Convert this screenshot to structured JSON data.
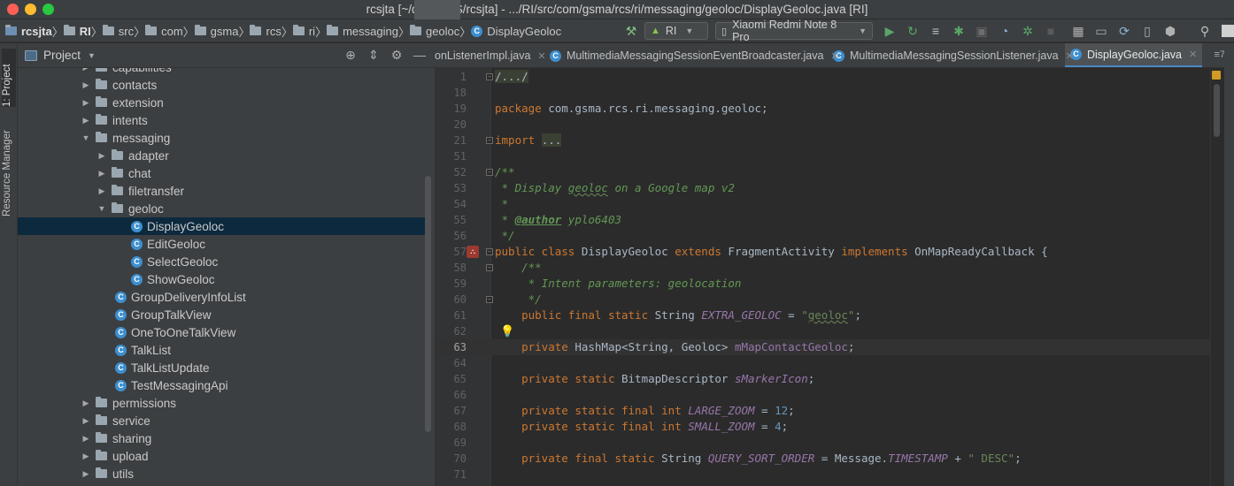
{
  "window": {
    "title": "rcsjta [~/dev/       RCS/rcsjta] - .../RI/src/com/gsma/rcs/ri/messaging/geoloc/DisplayGeoloc.java [RI]"
  },
  "breadcrumbs": [
    "rcsjta",
    "RI",
    "src",
    "com",
    "gsma",
    "rcs",
    "ri",
    "messaging",
    "geoloc",
    "DisplayGeoloc"
  ],
  "toolbar": {
    "module": "RI",
    "device": "Xiaomi Redmi Note 8 Pro"
  },
  "left_stripe": {
    "project_tab": "1: Project",
    "resource_tab": "Resource Manager"
  },
  "project_panel": {
    "title": "Project",
    "tree": [
      {
        "label": "capabilities",
        "type": "folder",
        "depth": 0,
        "state": "collapsed"
      },
      {
        "label": "contacts",
        "type": "folder",
        "depth": 0,
        "state": "collapsed"
      },
      {
        "label": "extension",
        "type": "folder",
        "depth": 0,
        "state": "collapsed"
      },
      {
        "label": "intents",
        "type": "folder",
        "depth": 0,
        "state": "collapsed"
      },
      {
        "label": "messaging",
        "type": "folder",
        "depth": 0,
        "state": "expanded"
      },
      {
        "label": "adapter",
        "type": "folder",
        "depth": 1,
        "state": "collapsed"
      },
      {
        "label": "chat",
        "type": "folder",
        "depth": 1,
        "state": "collapsed"
      },
      {
        "label": "filetransfer",
        "type": "folder",
        "depth": 1,
        "state": "collapsed"
      },
      {
        "label": "geoloc",
        "type": "folder",
        "depth": 1,
        "state": "expanded"
      },
      {
        "label": "DisplayGeoloc",
        "type": "class",
        "depth": 2,
        "state": "selected"
      },
      {
        "label": "EditGeoloc",
        "type": "class",
        "depth": 2,
        "state": ""
      },
      {
        "label": "SelectGeoloc",
        "type": "class",
        "depth": 2,
        "state": ""
      },
      {
        "label": "ShowGeoloc",
        "type": "class",
        "depth": 2,
        "state": ""
      },
      {
        "label": "GroupDeliveryInfoList",
        "type": "class",
        "depth": 1,
        "state": ""
      },
      {
        "label": "GroupTalkView",
        "type": "class",
        "depth": 1,
        "state": ""
      },
      {
        "label": "OneToOneTalkView",
        "type": "class",
        "depth": 1,
        "state": ""
      },
      {
        "label": "TalkList",
        "type": "class",
        "depth": 1,
        "state": ""
      },
      {
        "label": "TalkListUpdate",
        "type": "class",
        "depth": 1,
        "state": ""
      },
      {
        "label": "TestMessagingApi",
        "type": "class",
        "depth": 1,
        "state": ""
      },
      {
        "label": "permissions",
        "type": "folder",
        "depth": 0,
        "state": "collapsed"
      },
      {
        "label": "service",
        "type": "folder",
        "depth": 0,
        "state": "collapsed"
      },
      {
        "label": "sharing",
        "type": "folder",
        "depth": 0,
        "state": "collapsed"
      },
      {
        "label": "upload",
        "type": "folder",
        "depth": 0,
        "state": "collapsed"
      },
      {
        "label": "utils",
        "type": "folder",
        "depth": 0,
        "state": "collapsed"
      }
    ]
  },
  "editor_tabs": [
    {
      "label": "onListenerImpl.java",
      "active": false,
      "icon": false
    },
    {
      "label": "MultimediaMessagingSessionEventBroadcaster.java",
      "active": false,
      "icon": true
    },
    {
      "label": "MultimediaMessagingSessionListener.java",
      "active": false,
      "icon": true
    },
    {
      "label": "DisplayGeoloc.java",
      "active": true,
      "icon": true
    }
  ],
  "editor_tabs_more": "7",
  "current_line": 63,
  "code_lines": [
    {
      "n": "1",
      "html": "<span class=\"fold-box\">/.../</span>"
    },
    {
      "n": "18",
      "html": ""
    },
    {
      "n": "19",
      "html": "<span class=\"kw\">package</span> com.gsma.rcs.ri.messaging.geoloc;"
    },
    {
      "n": "20",
      "html": ""
    },
    {
      "n": "21",
      "html": "<span class=\"kw\">import</span> <span class=\"fold-box\">...</span>"
    },
    {
      "n": "51",
      "html": ""
    },
    {
      "n": "52",
      "html": "<span class=\"cm\">/**</span>"
    },
    {
      "n": "53",
      "html": "<span class=\"cm\"> * Display <span class=\"wavy\">geoloc</span> on a Google map v2</span>"
    },
    {
      "n": "54",
      "html": "<span class=\"cm\"> *</span>"
    },
    {
      "n": "55",
      "html": "<span class=\"cm\"> * </span><span class=\"tag\">@author</span><span class=\"cm\"> yplo6403</span>"
    },
    {
      "n": "56",
      "html": "<span class=\"cm\"> */</span>"
    },
    {
      "n": "57",
      "html": "<span class=\"kw\">public class</span> DisplayGeoloc <span class=\"kw\">extends</span> FragmentActivity <span class=\"kw\">implements</span> OnMapReadyCallback {"
    },
    {
      "n": "58",
      "html": "    <span class=\"cm\">/**</span>"
    },
    {
      "n": "59",
      "html": "<span class=\"cm\">     * Intent parameters: geolocation</span>"
    },
    {
      "n": "60",
      "html": "<span class=\"cm\">     */</span>"
    },
    {
      "n": "61",
      "html": "    <span class=\"kw\">public final static</span> String <span class=\"cn\">EXTRA_GEOLOC</span> = <span class=\"st\">\"<span class=\"wavy\">geoloc</span>\"</span>;"
    },
    {
      "n": "62",
      "html": ""
    },
    {
      "n": "63",
      "html": "    <span class=\"kw\">private</span> HashMap&lt;String, Geoloc&gt; <span class=\"fd\">mMapContactGeoloc</span>;"
    },
    {
      "n": "64",
      "html": ""
    },
    {
      "n": "65",
      "html": "    <span class=\"kw\">private static</span> BitmapDescriptor <span class=\"cn\">sMarkerIcon</span>;"
    },
    {
      "n": "66",
      "html": ""
    },
    {
      "n": "67",
      "html": "    <span class=\"kw\">private static final int</span> <span class=\"cn\">LARGE_ZOOM</span> = <span class=\"num\">12</span>;"
    },
    {
      "n": "68",
      "html": "    <span class=\"kw\">private static final int</span> <span class=\"cn\">SMALL_ZOOM</span> = <span class=\"num\">4</span>;"
    },
    {
      "n": "69",
      "html": ""
    },
    {
      "n": "70",
      "html": "    <span class=\"kw\">private final static</span> String <span class=\"cn\">QUERY_SORT_ORDER</span> = Message.<span class=\"cn\">TIMESTAMP</span> + <span class=\"st\">\" DESC\"</span>;"
    },
    {
      "n": "71",
      "html": ""
    }
  ]
}
